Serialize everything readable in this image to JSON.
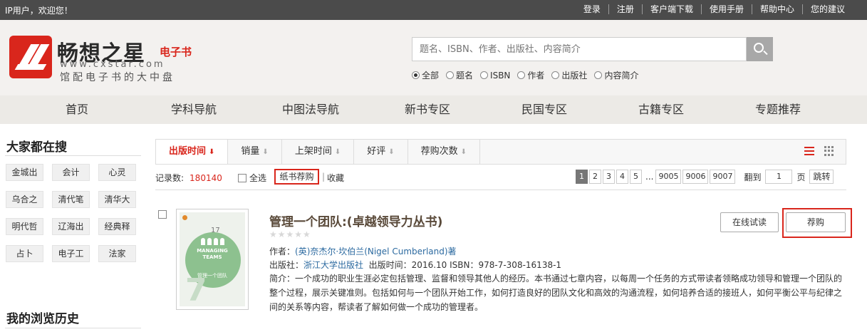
{
  "topbar": {
    "welcome": "IP用户，欢迎您！",
    "links": [
      "登录",
      "注册",
      "客户端下载",
      "使用手册",
      "帮助中心",
      "您的建议"
    ]
  },
  "brand": {
    "name": "畅想之星",
    "sub": "电子书",
    "url": "www.cxstar.com",
    "slogan": "馆配电子书的大中盘",
    "logo_color": "#d9261c"
  },
  "search": {
    "placeholder": "题名、ISBN、作者、出版社、内容简介",
    "icon": "search-icon",
    "options": [
      {
        "label": "全部",
        "selected": true
      },
      {
        "label": "题名",
        "selected": false
      },
      {
        "label": "ISBN",
        "selected": false
      },
      {
        "label": "作者",
        "selected": false
      },
      {
        "label": "出版社",
        "selected": false
      },
      {
        "label": "内容简介",
        "selected": false
      }
    ]
  },
  "nav": [
    "首页",
    "学科导航",
    "中图法导航",
    "新书专区",
    "民国专区",
    "古籍专区",
    "专题推荐"
  ],
  "sidebar": {
    "title": "大家都在搜",
    "tags": [
      "金城出",
      "会计",
      "心灵",
      "乌合之",
      "清代笔",
      "清华大",
      "明代哲",
      "辽海出",
      "经典释",
      "占卜",
      "电子工",
      "法家"
    ],
    "history_title": "我的浏览历史"
  },
  "sort": {
    "items": [
      {
        "label": "出版时间",
        "active": true,
        "arrow": "⬇"
      },
      {
        "label": "销量",
        "active": false,
        "arrow": "⬇"
      },
      {
        "label": "上架时间",
        "active": false,
        "arrow": "⬇"
      },
      {
        "label": "好评",
        "active": false,
        "arrow": "⬇"
      },
      {
        "label": "荐购次数",
        "active": false,
        "arrow": "⬇"
      }
    ]
  },
  "records": {
    "label": "记录数:",
    "count": "180140",
    "select_all": "全选",
    "paper_recommend": "纸书荐购",
    "separator": "|",
    "favorite": "收藏"
  },
  "pager": {
    "pages": [
      "1",
      "2",
      "3",
      "4",
      "5"
    ],
    "dots": "...",
    "last_pages": [
      "9005",
      "9006",
      "9007"
    ],
    "current": "1",
    "jump_label": "翻到",
    "jump_value": "1",
    "page_word": "页",
    "jump_button": "跳转"
  },
  "book": {
    "title": "管理一个团队:(卓越领导力丛书)",
    "stars": "★★★★★",
    "author_label": "作者：",
    "author": "(英)奈杰尔·坎伯兰(Nigel Cumberland)著",
    "publisher_label": "出版社：",
    "publisher": "浙江大学出版社",
    "pub_info": "出版时间：2016.10  ISBN：978-7-308-16138-1",
    "intro": "简介：一个成功的职业生涯必定包括管理、监督和领导其他人的经历。本书通过七章内容，以每周一个任务的方式带读者领略成功领导和管理一个团队的整个过程，展示关键准则。包括如何与一个团队开始工作，如何打造良好的团队文化和高效的沟通流程，如何培养合适的接班人，如何平衡公平与纪律之间的关系等内容，帮读者了解如何做一个成功的管理者。",
    "trial_button": "在线试读",
    "buy_button": "荐购",
    "cover": {
      "number": "17",
      "title_en_1": "MANAGING",
      "title_en_2": "TEAMS",
      "title_cn": "管理一个团队",
      "big_number": "7",
      "color": "#8dc18f"
    }
  }
}
